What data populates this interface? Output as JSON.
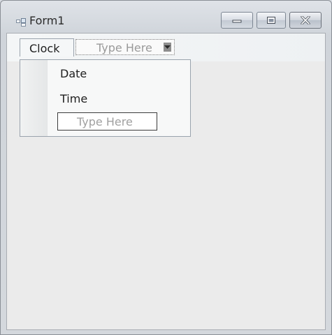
{
  "window": {
    "title": "Form1",
    "icons": {
      "app": "form-icon",
      "minimize": "minimize-icon",
      "maximize": "maximize-icon",
      "close": "close-icon"
    }
  },
  "menustrip": {
    "items": [
      {
        "label": "Clock",
        "icon": "none"
      }
    ],
    "new_item_placeholder": "Type Here",
    "new_item_dropdown_icon": "chevron-down-icon"
  },
  "dropdown": {
    "items": [
      {
        "label": "Date"
      },
      {
        "label": "Time"
      }
    ],
    "new_item_placeholder": "Type Here"
  },
  "colors": {
    "client_background": "#ebebeb",
    "menustrip_background": "#f4f6f7",
    "placeholder_text": "#9a9a9a"
  }
}
